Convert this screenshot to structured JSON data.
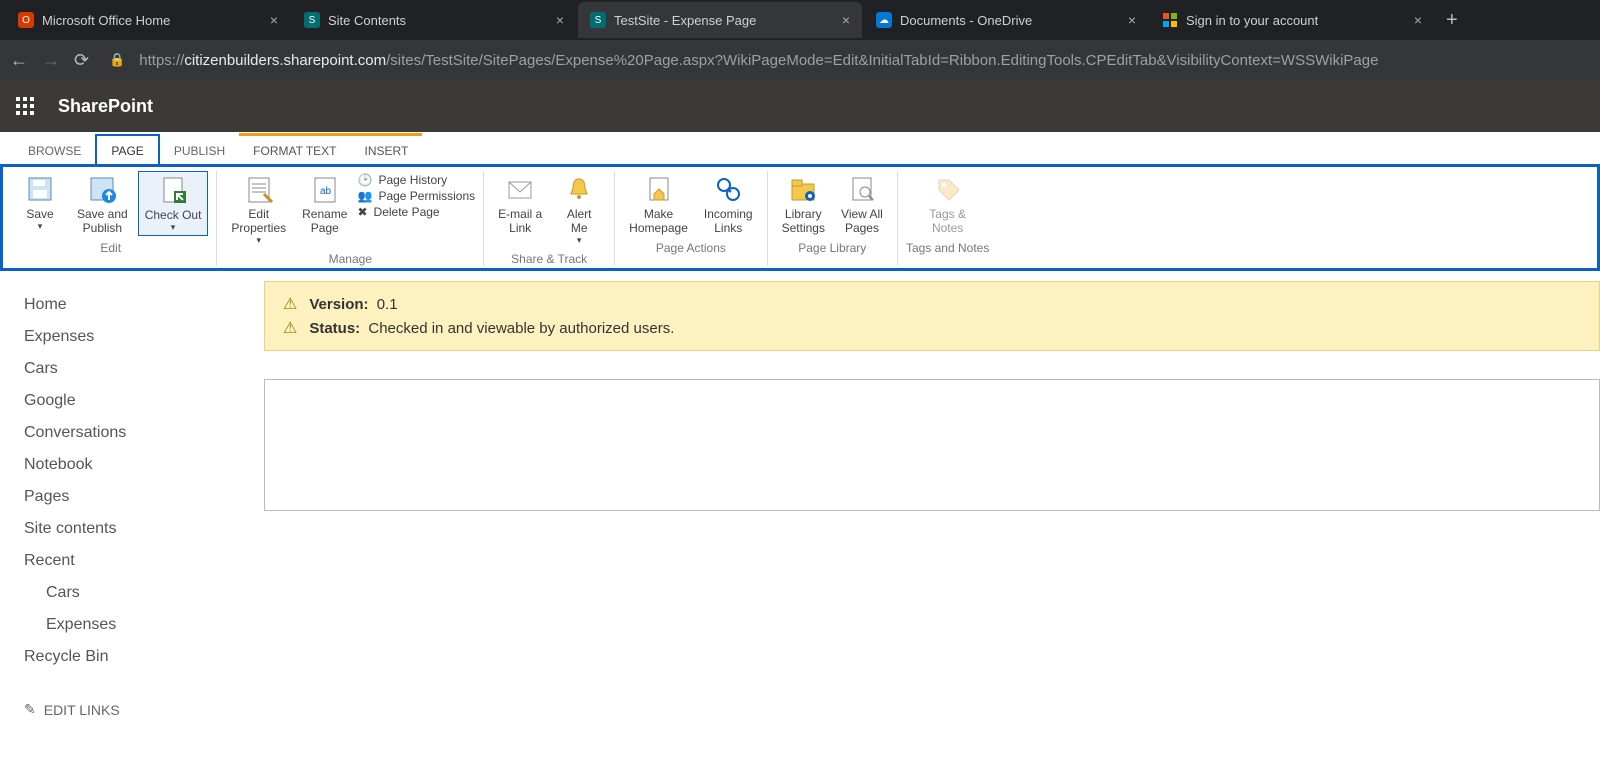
{
  "browser": {
    "tabs": [
      {
        "title": "Microsoft Office Home",
        "favicon": "office"
      },
      {
        "title": "Site Contents",
        "favicon": "sp"
      },
      {
        "title": "TestSite - Expense Page",
        "favicon": "sp",
        "active": true
      },
      {
        "title": "Documents - OneDrive",
        "favicon": "onedrive"
      },
      {
        "title": "Sign in to your account",
        "favicon": "ms"
      }
    ],
    "url_prefix": "https://",
    "url_host": "citizenbuilders.sharepoint.com",
    "url_path": "/sites/TestSite/SitePages/Expense%20Page.aspx?WikiPageMode=Edit&InitialTabId=Ribbon.EditingTools.CPEditTab&VisibilityContext=WSSWikiPage"
  },
  "sp_brand": "SharePoint",
  "ribbon_tabs": {
    "browse": "BROWSE",
    "page": "PAGE",
    "publish": "PUBLISH",
    "format_text": "FORMAT TEXT",
    "insert": "INSERT"
  },
  "ribbon": {
    "edit": {
      "save": "Save",
      "save_publish": "Save and\nPublish",
      "check_out": "Check Out",
      "label": "Edit"
    },
    "manage": {
      "edit_properties": "Edit\nProperties",
      "rename": "Rename\nPage",
      "page_history": "Page History",
      "page_permissions": "Page Permissions",
      "delete_page": "Delete Page",
      "label": "Manage"
    },
    "share": {
      "email": "E-mail a\nLink",
      "alert": "Alert\nMe",
      "label": "Share & Track"
    },
    "page_actions": {
      "make_home": "Make\nHomepage",
      "incoming": "Incoming\nLinks",
      "label": "Page Actions"
    },
    "page_library": {
      "settings": "Library\nSettings",
      "view_all": "View All\nPages",
      "label": "Page Library"
    },
    "tags": {
      "tags": "Tags &\nNotes",
      "label": "Tags and Notes"
    }
  },
  "leftnav": {
    "items": [
      "Home",
      "Expenses",
      "Cars",
      "Google",
      "Conversations",
      "Notebook",
      "Pages",
      "Site contents"
    ],
    "recent_label": "Recent",
    "recent_items": [
      "Cars",
      "Expenses"
    ],
    "recycle": "Recycle Bin",
    "edit_links": "EDIT LINKS"
  },
  "status": {
    "version_label": "Version:",
    "version_value": "0.1",
    "status_label": "Status:",
    "status_value": "Checked in and viewable by authorized users."
  }
}
